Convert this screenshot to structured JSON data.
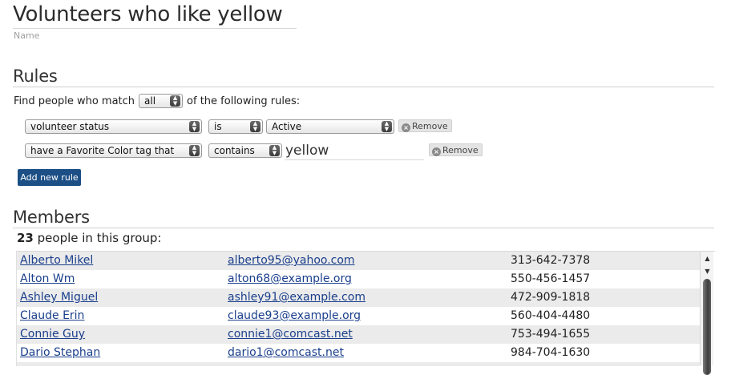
{
  "group": {
    "name": "Volunteers who like yellow",
    "name_label": "Name"
  },
  "rules_section": {
    "heading": "Rules",
    "match_prefix": "Find people who match",
    "match_value": "all",
    "match_suffix": "of the following rules:",
    "rules": [
      {
        "field": "volunteer status",
        "operator": "is",
        "value": "Active",
        "remove_label": "Remove"
      },
      {
        "field": "have a Favorite Color tag that",
        "operator": "contains",
        "value": "yellow",
        "remove_label": "Remove"
      }
    ],
    "add_rule_label": "Add new rule"
  },
  "members_section": {
    "heading": "Members",
    "count": "23",
    "count_suffix": "people in this group:",
    "rows": [
      {
        "name": "Alberto Mikel",
        "email": "alberto95@yahoo.com",
        "phone": "313-642-7378"
      },
      {
        "name": "Alton Wm",
        "email": "alton68@example.org",
        "phone": "550-456-1457"
      },
      {
        "name": "Ashley Miguel",
        "email": "ashley91@example.com",
        "phone": "472-909-1818"
      },
      {
        "name": "Claude Erin",
        "email": "claude93@example.org",
        "phone": "560-404-4480"
      },
      {
        "name": "Connie Guy",
        "email": "connie1@comcast.net",
        "phone": "753-494-1655"
      },
      {
        "name": "Dario Stephan",
        "email": "dario1@comcast.net",
        "phone": "984-704-1630"
      },
      {
        "name": "",
        "email": "",
        "phone": ""
      }
    ]
  },
  "icons": {
    "remove": "remove-x-icon",
    "select": "select-arrows-icon",
    "scroll_up": "scroll-up-arrow-icon",
    "scroll_down": "scroll-down-arrow-icon"
  }
}
